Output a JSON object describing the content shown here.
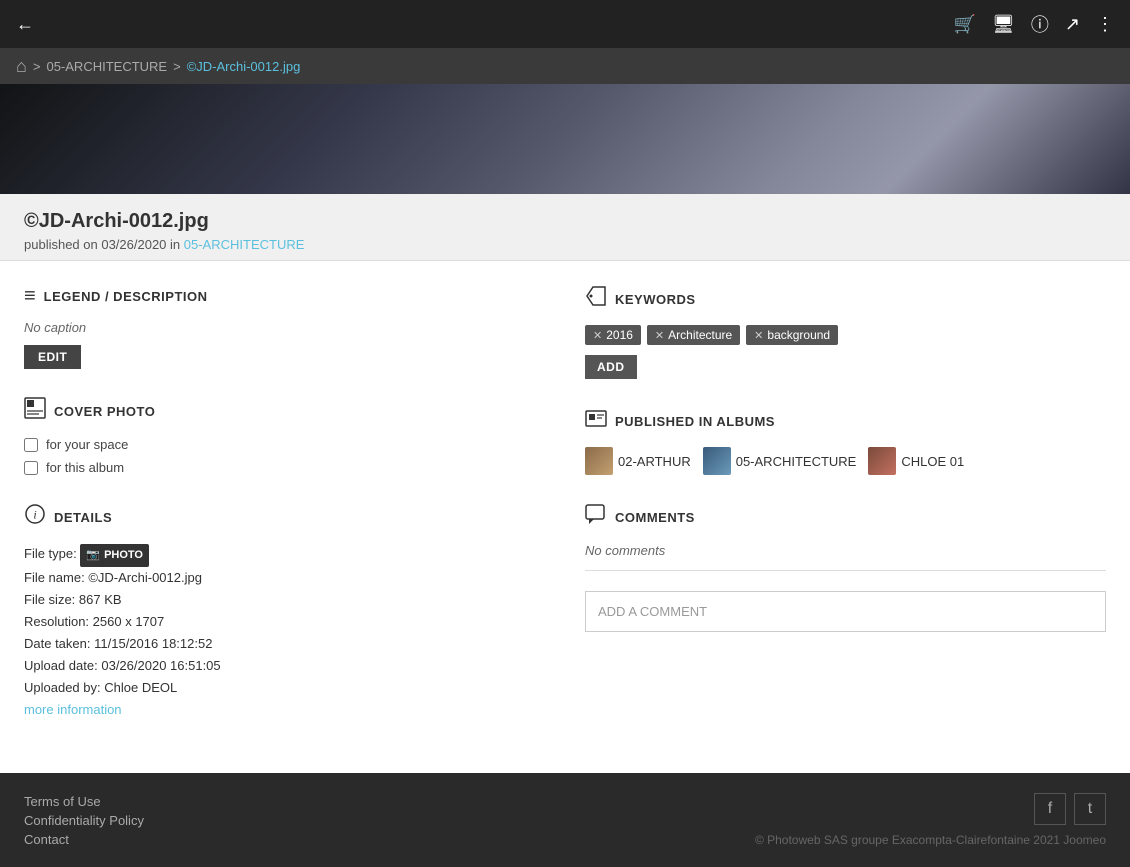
{
  "topNav": {
    "back_icon": "←",
    "basket_icon": "🛒",
    "monitor_icon": "🖥",
    "info_icon": "ⓘ",
    "share_icon": "↗",
    "menu_icon": "⋮"
  },
  "breadcrumb": {
    "home_icon": "⌂",
    "sep1": ">",
    "folder": "05-ARCHITECTURE",
    "sep2": ">",
    "current": "©JD-Archi-0012.jpg"
  },
  "pageTitle": {
    "title": "©JD-Archi-0012.jpg",
    "publish_prefix": "published on 03/26/2020 in",
    "publish_album": "05-ARCHITECTURE"
  },
  "leftCol": {
    "legendSection": {
      "icon": "≡",
      "heading": "LEGEND / DESCRIPTION",
      "no_caption": "No caption",
      "edit_btn": "EDIT"
    },
    "coverSection": {
      "icon": "⬜",
      "heading": "COVER PHOTO",
      "checkbox1": "for your space",
      "checkbox2": "for this album"
    },
    "detailsSection": {
      "icon": "ⓘ",
      "heading": "DETAILS",
      "file_type_label": "File type:",
      "file_type_icon": "📷",
      "file_type_value": "PHOTO",
      "file_name_label": "File name:",
      "file_name_value": "©JD-Archi-0012.jpg",
      "file_size_label": "File size:",
      "file_size_value": "867 KB",
      "resolution_label": "Resolution:",
      "resolution_value": "2560 x 1707",
      "date_taken_label": "Date taken:",
      "date_taken_value": "11/15/2016 18:12:52",
      "upload_date_label": "Upload date:",
      "upload_date_value": "03/26/2020 16:51:05",
      "uploaded_by_label": "Uploaded by:",
      "uploaded_by_value": "Chloe DEOL",
      "more_info": "more information"
    }
  },
  "rightCol": {
    "keywordsSection": {
      "icon": "🏷",
      "heading": "KEYWORDS",
      "tags": [
        {
          "label": "2016"
        },
        {
          "label": "Architecture"
        },
        {
          "label": "background"
        }
      ],
      "add_btn": "ADD"
    },
    "albumsSection": {
      "icon": "⬜",
      "heading": "PUBLISHED IN ALBUMS",
      "albums": [
        {
          "name": "02-ARTHUR",
          "thumb_type": "arthur"
        },
        {
          "name": "05-ARCHITECTURE",
          "thumb_type": "archi"
        },
        {
          "name": "CHLOE 01",
          "thumb_type": "chloe"
        }
      ]
    },
    "commentsSection": {
      "icon": "💬",
      "heading": "COMMENTS",
      "no_comments": "No comments",
      "add_placeholder": "ADD A COMMENT"
    }
  },
  "footer": {
    "links": [
      {
        "label": "Terms of Use"
      },
      {
        "label": "Confidentiality Policy"
      },
      {
        "label": "Contact"
      }
    ],
    "social": [
      {
        "icon": "f",
        "name": "facebook"
      },
      {
        "icon": "t",
        "name": "twitter"
      }
    ],
    "copyright": "© Photoweb SAS groupe Exacompta-Clairefontaine 2021 Joomeo"
  }
}
